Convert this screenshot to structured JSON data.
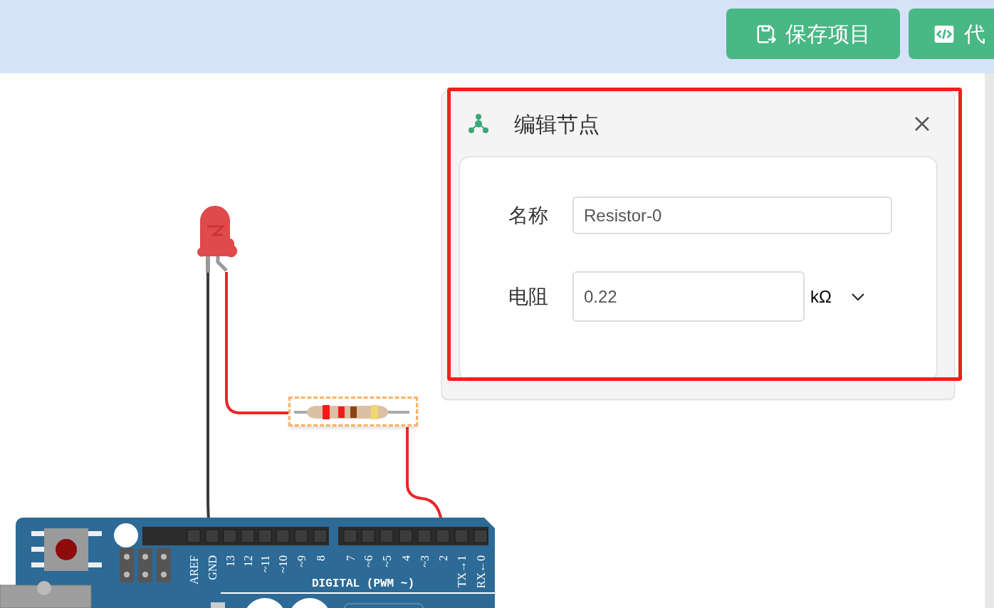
{
  "toolbar": {
    "buttons": [
      {
        "kind": "save",
        "label": "保存项目"
      },
      {
        "kind": "code",
        "label": "代"
      }
    ]
  },
  "editor_panel": {
    "title": "编辑节点",
    "fields": [
      {
        "kind": "text",
        "label": "名称",
        "value": "Resistor-0"
      },
      {
        "kind": "unit",
        "label": "电阻",
        "value": "0.22",
        "unit": "kΩ"
      }
    ]
  },
  "board": {
    "pins": [
      "AREF",
      "GND",
      "13",
      "12",
      "~11",
      "~10",
      "~9",
      "8",
      "7",
      "~6",
      "~5",
      "4",
      "~3",
      "2",
      "TX→1",
      "RX←0"
    ],
    "digital_label": "DIGITAL (PWM ~)"
  }
}
